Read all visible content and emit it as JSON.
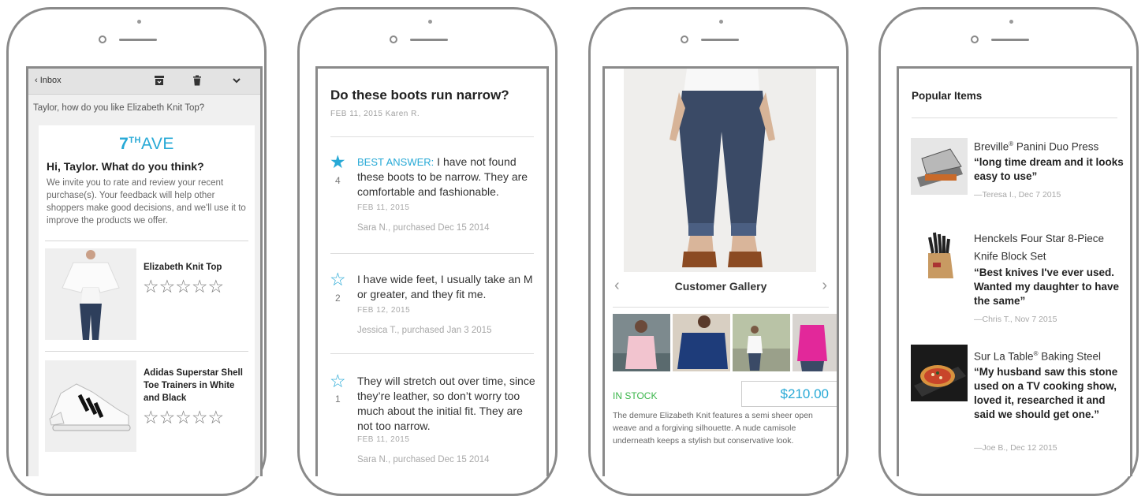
{
  "phone1": {
    "back_label": "Inbox",
    "subject": "Taylor, how do you like Elizabeth Knit Top?",
    "brand_num": "7",
    "brand_sup": "TH",
    "brand_word": "AVE",
    "greeting": "Hi, Taylor. What do you think?",
    "invite": "We invite you to rate and review your recent purchase(s). Your feedback will help other shoppers make good decisions, and we'll use it to improve the products we offer.",
    "products": [
      {
        "name": "Elizabeth Knit Top",
        "stars": "☆☆☆☆☆",
        "rating": 0
      },
      {
        "name": "Adidas Superstar Shell Toe Trainers in White and Black",
        "stars": "☆☆☆☆☆",
        "rating": 0
      }
    ]
  },
  "phone2": {
    "question": "Do these boots run narrow?",
    "meta": "FEB 11, 2015  Karen R.",
    "answers": [
      {
        "star": "★",
        "votes": "4",
        "best_label": "BEST ANSWER:",
        "text": " I have not found these boots to be narrow. They are comfortable and fashionable.",
        "date": "FEB 11, 2015",
        "by": "Sara N., purchased Dec 15 2014"
      },
      {
        "star": "☆",
        "votes": "2",
        "best_label": "",
        "text": "I have wide feet, I usually take an M or greater, and they fit me.",
        "date": "FEB 12, 2015",
        "by": "Jessica T., purchased Jan 3 2015"
      },
      {
        "star": "☆",
        "votes": "1",
        "best_label": "",
        "text": "They will stretch out over time, since they’re leather, so don’t worry too much about the initial fit. They are not too narrow.",
        "date": "FEB 11, 2015",
        "by": "Sara N., purchased Dec 15 2014"
      }
    ]
  },
  "phone3": {
    "gallery_title": "Customer Gallery",
    "prev": "‹",
    "next": "›",
    "stock": "IN STOCK",
    "price": "$210.00",
    "description": "The demure Elizabeth Knit features a semi sheer open weave and a forgiving silhouette. A nude camisole underneath keeps a stylish but conservative look."
  },
  "phone4": {
    "title": "Popular Items",
    "items": [
      {
        "name_a": "Breville",
        "reg": "®",
        "name_b": " Panini Duo Press",
        "quote": "“long time dream and it looks easy to use”",
        "by": "—Teresa I., Dec 7 2015"
      },
      {
        "name_a": "Henckels Four Star 8-Piece Knife Block Set",
        "reg": "",
        "name_b": "",
        "quote": "“Best knives I've ever used. Wanted my daughter to have the same”",
        "by": "—Chris T., Nov 7 2015"
      },
      {
        "name_a": "Sur La Table",
        "reg": "®",
        "name_b": " Baking Steel",
        "quote": "“My husband saw this stone used on a TV cooking show, loved it, researched it and said we should get one.”",
        "by": "—Joe B., Dec 12 2015"
      }
    ]
  },
  "colors": {
    "accent": "#27a9d6",
    "stock_green": "#3ab54a",
    "frame": "#8a8a8a"
  },
  "icons": [
    "chevron-left-icon",
    "archive-icon",
    "trash-icon",
    "chevron-down-icon",
    "star-icon"
  ]
}
